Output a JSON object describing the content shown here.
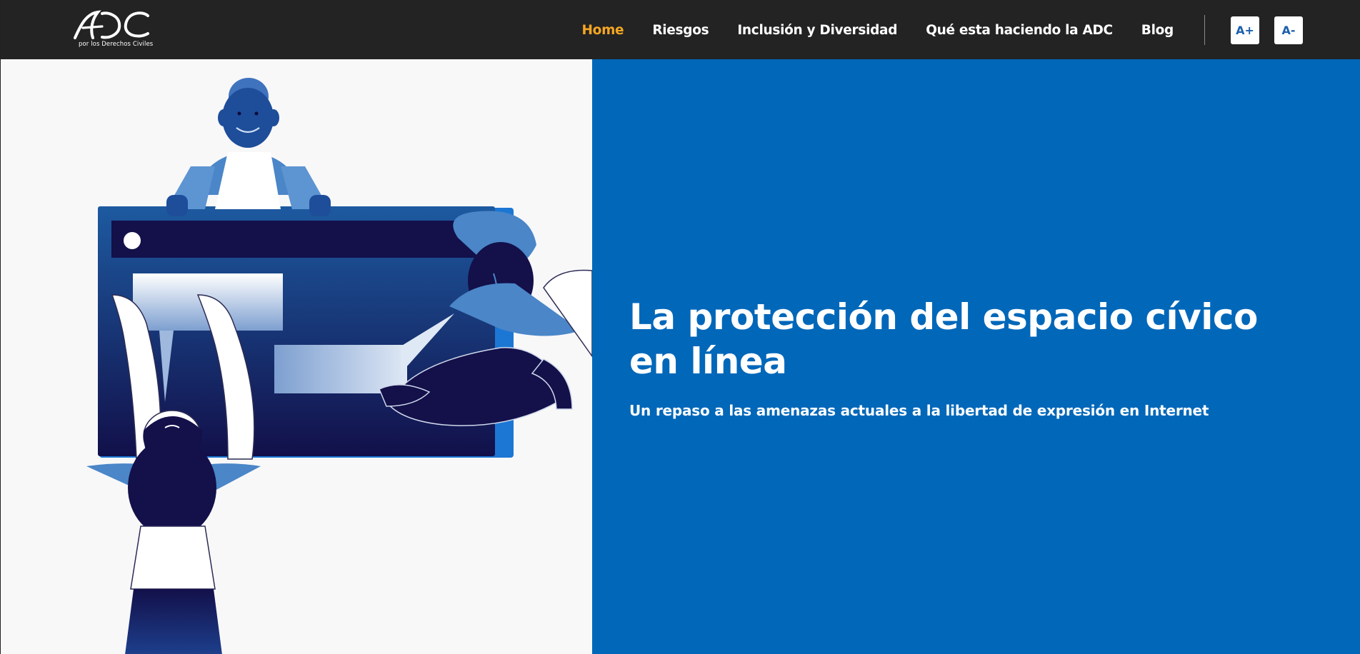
{
  "header": {
    "logo_tagline": "por los Derechos Civiles",
    "nav": [
      {
        "label": "Home",
        "active": true
      },
      {
        "label": "Riesgos",
        "active": false
      },
      {
        "label": "Inclusión y Diversidad",
        "active": false
      },
      {
        "label": "Qué esta haciendo la ADC",
        "active": false
      },
      {
        "label": "Blog",
        "active": false
      }
    ],
    "font_increase_label": "A+",
    "font_decrease_label": "A-"
  },
  "hero": {
    "title": "La protección del espacio cívico en línea",
    "subtitle": "Un repaso a las amenazas actuales a la libertad de expresión en Internet"
  },
  "colors": {
    "header_bg": "#232323",
    "nav_active": "#f5a623",
    "hero_blue": "#0067b9",
    "illustration_navy": "#13104a",
    "illustration_blue": "#4a86c8"
  },
  "icons": {
    "logo": "adc-logo-icon",
    "illustration": "people-with-screen-illustration"
  }
}
